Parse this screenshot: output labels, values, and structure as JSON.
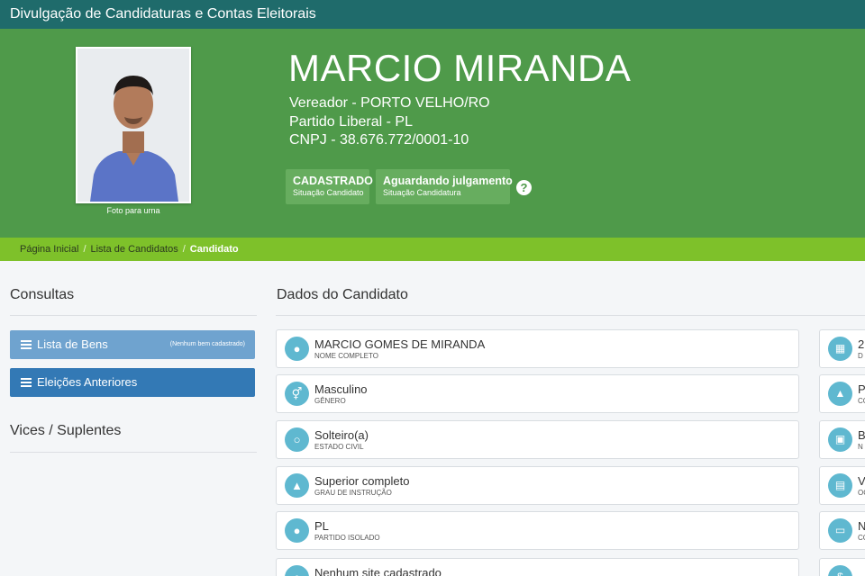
{
  "app": {
    "title": "Divulgação de Candidaturas e Contas Eleitorais"
  },
  "candidate": {
    "name": "MARCIO MIRANDA",
    "office": "Vereador - PORTO VELHO/RO",
    "party": "Partido Liberal - PL",
    "cnpj": "CNPJ - 38.676.772/0001-10",
    "photo_caption": "Foto para urna"
  },
  "status": {
    "candidate": {
      "value": "CADASTRADO",
      "label": "Situação Candidato"
    },
    "candidacy": {
      "value": "Aguardando julgamento",
      "label": "Situação Candidatura"
    },
    "help": "?"
  },
  "breadcrumb": {
    "items": [
      "Página Inicial",
      "Lista de Candidatos"
    ],
    "current": "Candidato",
    "separator": "/"
  },
  "sidebar": {
    "consultas_title": "Consultas",
    "bens": {
      "label": "Lista de Bens",
      "badge": "(Nenhum bem cadastrado)"
    },
    "eleicoes": {
      "label": "Eleições Anteriores"
    },
    "vices_title": "Vices / Suplentes"
  },
  "main": {
    "title": "Dados do Candidato",
    "fields": [
      {
        "value": "MARCIO GOMES DE MIRANDA",
        "label": "NOME COMPLETO",
        "icon": "user-icon"
      },
      {
        "value": "Masculino",
        "label": "GÊNERO",
        "icon": "gender-icon"
      },
      {
        "value": "Solteiro(a)",
        "label": "ESTADO CIVIL",
        "icon": "ring-icon"
      },
      {
        "value": "Superior completo",
        "label": "GRAU DE INSTRUÇÃO",
        "icon": "graduation-cap-icon"
      },
      {
        "value": "PL",
        "label": "PARTIDO ISOLADO",
        "icon": "group-icon"
      },
      {
        "value": "Nenhum site cadastrado",
        "label": "",
        "icon": "globe-icon"
      }
    ],
    "right_fields": [
      {
        "value": "2",
        "label": "D",
        "icon": "calendar-icon"
      },
      {
        "value": "P",
        "label": "CO",
        "icon": "shirt-icon"
      },
      {
        "value": "B",
        "label": "N",
        "icon": "map-icon"
      },
      {
        "value": "Ve",
        "label": "OC",
        "icon": "bank-icon"
      },
      {
        "value": "N",
        "label": "CO",
        "icon": "folder-icon"
      },
      {
        "value": "",
        "label": "",
        "icon": "dollar-icon"
      }
    ]
  },
  "colors": {
    "topbar": "#1f6b6b",
    "hero": "#4f9a4a",
    "breadcrumb": "#7ec12a",
    "icon_circle": "#5fb8d0",
    "btn_bens": "#6fa3cf",
    "btn_eleicoes": "#3379b5"
  }
}
